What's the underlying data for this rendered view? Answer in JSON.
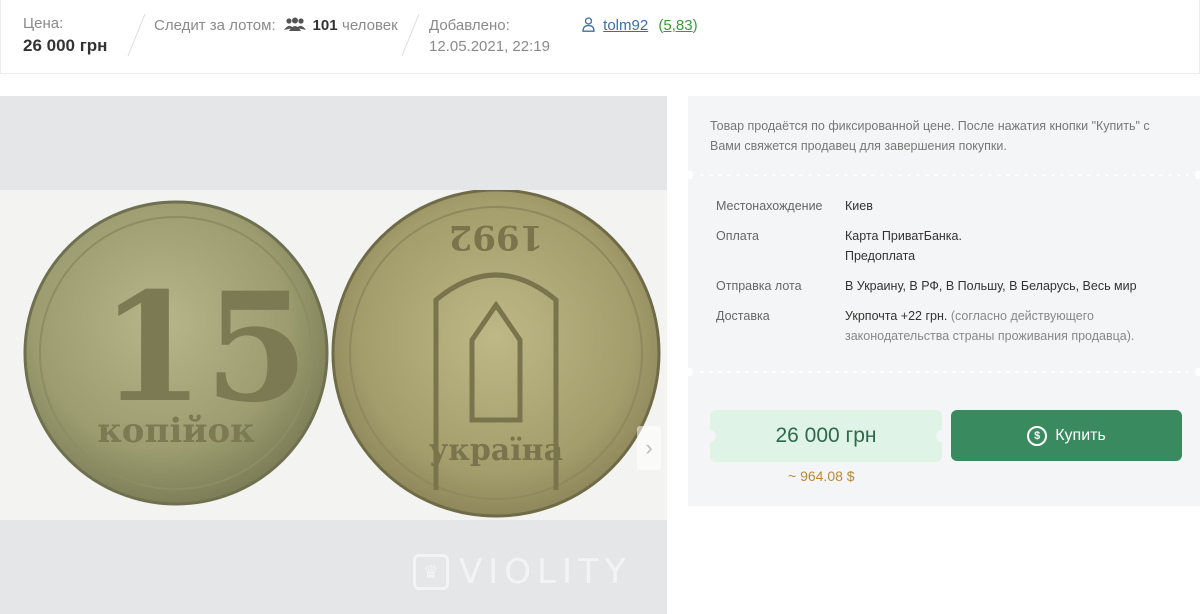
{
  "header": {
    "price_label": "Цена:",
    "price_value": "26 000 грн",
    "watchers_label": "Следит за лотом:",
    "watchers_icon": "people-icon",
    "watchers_count": "101",
    "watchers_unit": "человек",
    "added_label": "Добавлено:",
    "added_date": "12.05.2021, 22:19",
    "seller_icon": "user-icon",
    "seller_name": "tolm92",
    "seller_rating_open": "(",
    "seller_rating": "5,83",
    "seller_rating_close": ")"
  },
  "gallery": {
    "coin_left_value": "15",
    "coin_left_word": "копійок",
    "coin_right_year": "1992",
    "coin_right_word": "україна",
    "watermark": "VIOLITY",
    "watermark_icon": "violity-logo-icon",
    "next_icon": "chevron-right-icon",
    "next_glyph": "›"
  },
  "panel": {
    "notice": "Товар продаётся по фиксированной цене. После нажатия кнопки \"Купить\" с Вами свяжется продавец для завершения покупки.",
    "properties": [
      {
        "key": "Местонахождение",
        "value": "Киев",
        "note": ""
      },
      {
        "key": "Оплата",
        "value": "Карта ПриватБанка. Предоплата",
        "note": ""
      },
      {
        "key": "Отправка лота",
        "value": "В Украину, В РФ, В Польшу, В Беларусь, Весь мир",
        "note": ""
      },
      {
        "key": "Доставка",
        "value": "Укрпочта +22 грн.",
        "note": "(согласно действующего законодательства страны проживания продавца)."
      }
    ],
    "price": "26 000 грн",
    "price_usd": "~ 964.08 $",
    "buy_label": "Купить",
    "buy_icon": "dollar-coin-icon",
    "buy_icon_glyph": "$"
  },
  "colors": {
    "accent_green": "#3a8a5f",
    "price_bg": "#dff3e6",
    "link_blue": "#3a6fa8",
    "rating_green": "#3c9a3c",
    "usd_gold": "#b78a3b"
  }
}
